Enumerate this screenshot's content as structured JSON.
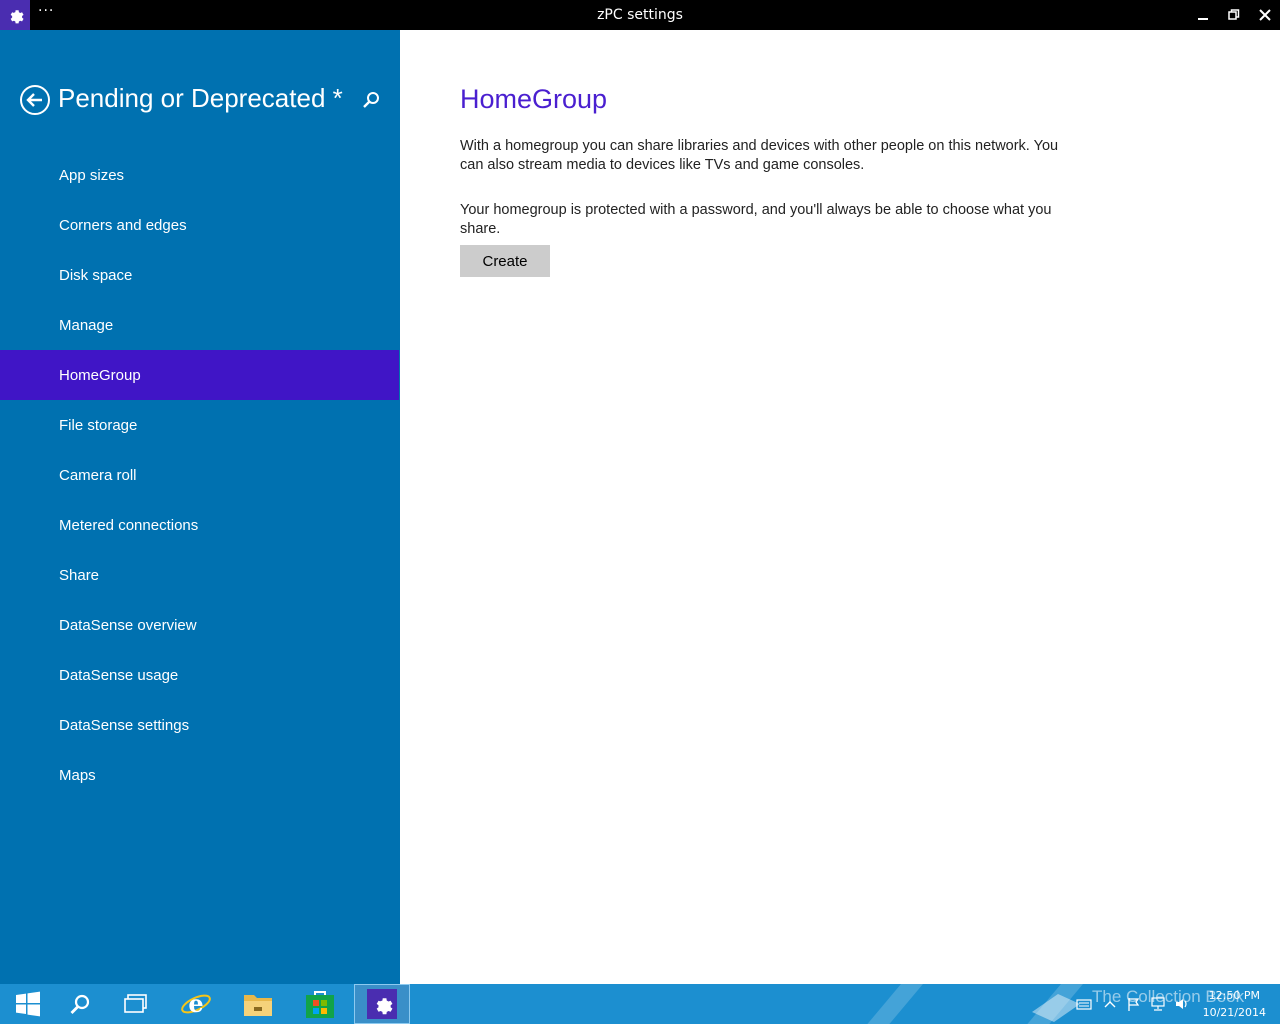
{
  "window": {
    "title": "zPC settings",
    "menu_glyph": "···",
    "minimize_glyph": "▁",
    "restore_glyph": "❐",
    "close_glyph": "✕"
  },
  "sidebar": {
    "title": "Pending or Deprecated *",
    "items": [
      {
        "label": "App sizes"
      },
      {
        "label": "Corners and edges"
      },
      {
        "label": "Disk space"
      },
      {
        "label": "Manage"
      },
      {
        "label": "HomeGroup",
        "selected": true
      },
      {
        "label": "File storage"
      },
      {
        "label": "Camera roll"
      },
      {
        "label": "Metered connections"
      },
      {
        "label": "Share"
      },
      {
        "label": "DataSense overview"
      },
      {
        "label": "DataSense usage"
      },
      {
        "label": "DataSense settings"
      },
      {
        "label": "Maps"
      }
    ]
  },
  "main": {
    "title": "HomeGroup",
    "paragraph_1": "With a homegroup you can share libraries and devices with other people on this network. You can also stream media to devices like TVs and game consoles.",
    "paragraph_2": "Your homegroup is protected with a password, and you'll always be able to choose what you share.",
    "create_label": "Create"
  },
  "taskbar": {
    "items": [
      "start-icon",
      "search-icon",
      "task-view-icon",
      "internet-explorer-icon",
      "file-explorer-icon",
      "store-icon",
      "settings-icon"
    ],
    "watermark": "The Collection Book",
    "time": "12:50 PM",
    "date": "10/21/2014"
  },
  "colors": {
    "sidebar_bg": "#0071b0",
    "selected_bg": "#4015c6",
    "accent": "#4a1fd0",
    "taskbar_bg": "#1c8fd0",
    "button_bg": "#cccccc"
  }
}
